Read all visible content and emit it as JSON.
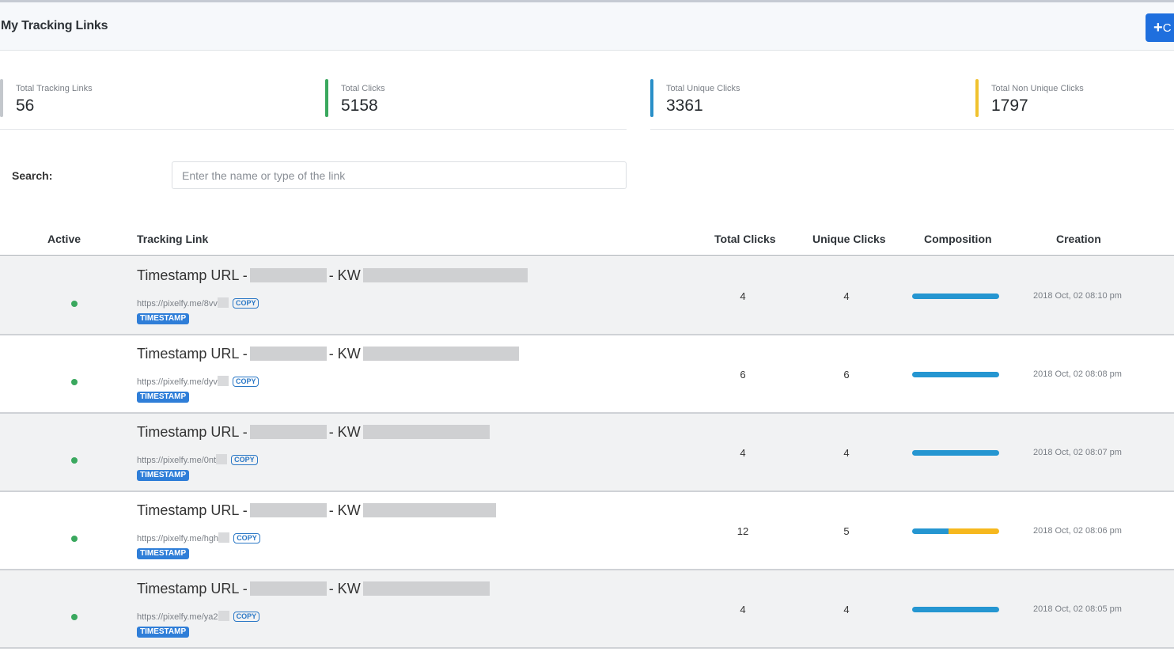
{
  "header": {
    "title": "My Tracking Links",
    "create_button_label": "C",
    "create_button_icon": "plus-icon"
  },
  "stats": [
    {
      "label": "Total Tracking Links",
      "value": "56",
      "color": "#c3c7cc"
    },
    {
      "label": "Total Clicks",
      "value": "5158",
      "color": "#3aa85e"
    },
    {
      "label": "Total Unique Clicks",
      "value": "3361",
      "color": "#2a8fc8"
    },
    {
      "label": "Total Non Unique Clicks",
      "value": "1797",
      "color": "#f0c22e"
    }
  ],
  "search": {
    "label": "Search:",
    "placeholder": "Enter the name or type of the link",
    "value": ""
  },
  "table": {
    "columns": [
      "Active",
      "Tracking Link",
      "Total Clicks",
      "Unique Clicks",
      "Composition",
      "Creation"
    ],
    "rows": [
      {
        "active": true,
        "title_prefix": "Timestamp URL -",
        "title_mid": "- KW",
        "url": "https://pixelfy.me/8vv",
        "copy_label": "COPY",
        "tag": "TIMESTAMP",
        "total_clicks": "4",
        "unique_clicks": "4",
        "composition_unique_fraction": 1.0,
        "created": "2018 Oct, 02 08:10 pm"
      },
      {
        "active": true,
        "title_prefix": "Timestamp URL -",
        "title_mid": "- KW",
        "url": "https://pixelfy.me/dyv",
        "copy_label": "COPY",
        "tag": "TIMESTAMP",
        "total_clicks": "6",
        "unique_clicks": "6",
        "composition_unique_fraction": 1.0,
        "created": "2018 Oct, 02 08:08 pm"
      },
      {
        "active": true,
        "title_prefix": "Timestamp URL -",
        "title_mid": "- KW",
        "url": "https://pixelfy.me/0nt",
        "copy_label": "COPY",
        "tag": "TIMESTAMP",
        "total_clicks": "4",
        "unique_clicks": "4",
        "composition_unique_fraction": 1.0,
        "created": "2018 Oct, 02 08:07 pm"
      },
      {
        "active": true,
        "title_prefix": "Timestamp URL -",
        "title_mid": "- KW",
        "url": "https://pixelfy.me/hgh",
        "copy_label": "COPY",
        "tag": "TIMESTAMP",
        "total_clicks": "12",
        "unique_clicks": "5",
        "composition_unique_fraction": 0.42,
        "created": "2018 Oct, 02 08:06 pm"
      },
      {
        "active": true,
        "title_prefix": "Timestamp URL -",
        "title_mid": "- KW",
        "url": "https://pixelfy.me/ya2",
        "copy_label": "COPY",
        "tag": "TIMESTAMP",
        "total_clicks": "4",
        "unique_clicks": "4",
        "composition_unique_fraction": 1.0,
        "created": "2018 Oct, 02 08:05 pm"
      }
    ]
  },
  "colors": {
    "unique": "#2596d1",
    "non_unique": "#f6b81e",
    "active_dot": "#3aa85e",
    "primary": "#1f6fde"
  }
}
